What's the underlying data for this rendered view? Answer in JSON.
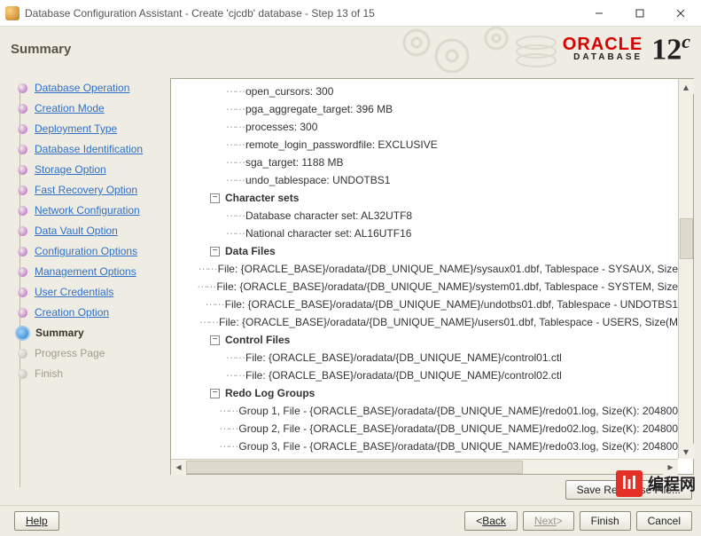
{
  "window": {
    "title": "Database Configuration Assistant - Create 'cjcdb' database - Step 13 of 15"
  },
  "header": {
    "title": "Summary",
    "brand_top": "ORACLE",
    "brand_bottom": "DATABASE",
    "version": "12"
  },
  "nav": {
    "items": [
      {
        "label": "Database Operation",
        "state": "done"
      },
      {
        "label": "Creation Mode",
        "state": "done"
      },
      {
        "label": "Deployment Type",
        "state": "done"
      },
      {
        "label": "Database Identification",
        "state": "done"
      },
      {
        "label": "Storage Option",
        "state": "done"
      },
      {
        "label": "Fast Recovery Option",
        "state": "done"
      },
      {
        "label": "Network Configuration",
        "state": "done"
      },
      {
        "label": "Data Vault Option",
        "state": "done"
      },
      {
        "label": "Configuration Options",
        "state": "done"
      },
      {
        "label": "Management Options",
        "state": "done"
      },
      {
        "label": "User Credentials",
        "state": "done"
      },
      {
        "label": "Creation Option",
        "state": "done"
      },
      {
        "label": "Summary",
        "state": "current"
      },
      {
        "label": "Progress Page",
        "state": "future"
      },
      {
        "label": "Finish",
        "state": "future"
      }
    ]
  },
  "tree": {
    "rows": [
      {
        "depth": 3,
        "leaf": true,
        "text": "open_cursors: 300"
      },
      {
        "depth": 3,
        "leaf": true,
        "text": "pga_aggregate_target: 396 MB"
      },
      {
        "depth": 3,
        "leaf": true,
        "text": "processes: 300"
      },
      {
        "depth": 3,
        "leaf": true,
        "text": "remote_login_passwordfile: EXCLUSIVE"
      },
      {
        "depth": 3,
        "leaf": true,
        "text": "sga_target: 1188 MB"
      },
      {
        "depth": 3,
        "leaf": true,
        "text": "undo_tablespace: UNDOTBS1"
      },
      {
        "depth": 2,
        "leaf": false,
        "bold": true,
        "text": "Character sets"
      },
      {
        "depth": 3,
        "leaf": true,
        "text": "Database character set: AL32UTF8"
      },
      {
        "depth": 3,
        "leaf": true,
        "text": "National character set: AL16UTF16"
      },
      {
        "depth": 2,
        "leaf": false,
        "bold": true,
        "text": "Data Files"
      },
      {
        "depth": 3,
        "leaf": true,
        "text": "File: {ORACLE_BASE}/oradata/{DB_UNIQUE_NAME}/sysaux01.dbf, Tablespace - SYSAUX, Size"
      },
      {
        "depth": 3,
        "leaf": true,
        "text": "File: {ORACLE_BASE}/oradata/{DB_UNIQUE_NAME}/system01.dbf, Tablespace - SYSTEM, Size"
      },
      {
        "depth": 3,
        "leaf": true,
        "text": "File: {ORACLE_BASE}/oradata/{DB_UNIQUE_NAME}/undotbs01.dbf, Tablespace - UNDOTBS1"
      },
      {
        "depth": 3,
        "leaf": true,
        "text": "File: {ORACLE_BASE}/oradata/{DB_UNIQUE_NAME}/users01.dbf, Tablespace - USERS, Size(M"
      },
      {
        "depth": 2,
        "leaf": false,
        "bold": true,
        "text": "Control Files"
      },
      {
        "depth": 3,
        "leaf": true,
        "text": "File: {ORACLE_BASE}/oradata/{DB_UNIQUE_NAME}/control01.ctl"
      },
      {
        "depth": 3,
        "leaf": true,
        "text": "File: {ORACLE_BASE}/oradata/{DB_UNIQUE_NAME}/control02.ctl"
      },
      {
        "depth": 2,
        "leaf": false,
        "bold": true,
        "text": "Redo Log Groups"
      },
      {
        "depth": 3,
        "leaf": true,
        "text": "Group 1, File - {ORACLE_BASE}/oradata/{DB_UNIQUE_NAME}/redo01.log, Size(K): 204800"
      },
      {
        "depth": 3,
        "leaf": true,
        "text": "Group 2, File - {ORACLE_BASE}/oradata/{DB_UNIQUE_NAME}/redo02.log, Size(K): 204800"
      },
      {
        "depth": 3,
        "leaf": true,
        "text": "Group 3, File - {ORACLE_BASE}/oradata/{DB_UNIQUE_NAME}/redo03.log, Size(K): 204800"
      }
    ]
  },
  "buttons": {
    "save_response": "Save Response File...",
    "help": "Help",
    "back": "Back",
    "next": "Next",
    "finish": "Finish",
    "cancel": "Cancel"
  },
  "watermark": {
    "logo": "lıl",
    "text": "编程网"
  }
}
